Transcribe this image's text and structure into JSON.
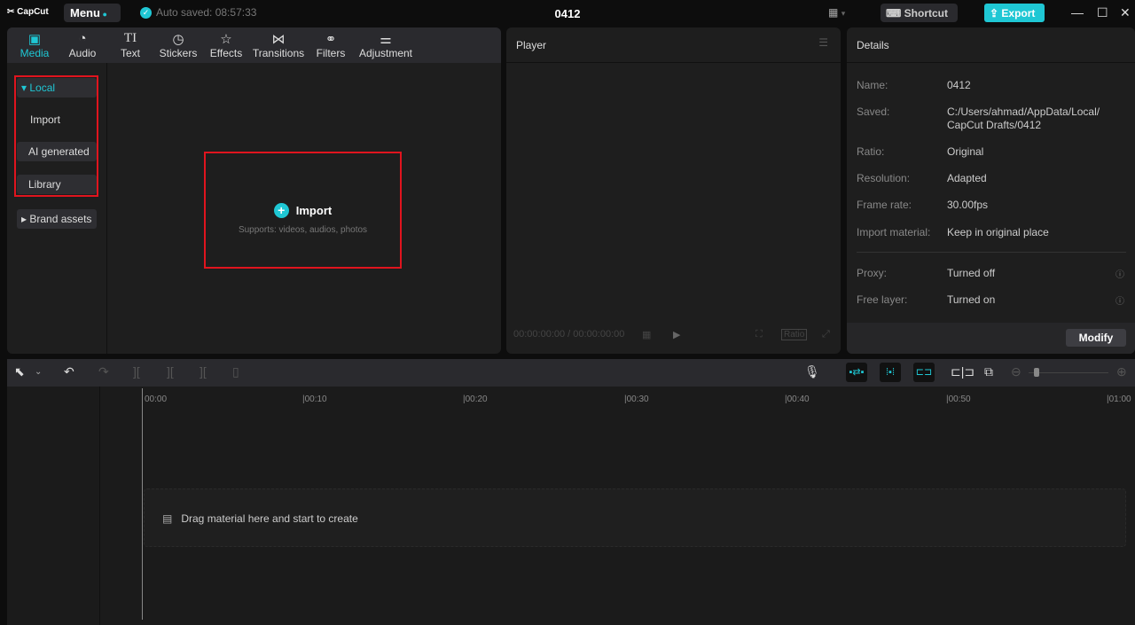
{
  "topbar": {
    "logo": "CapCut",
    "menu": "Menu",
    "autosave": "Auto saved: 08:57:33",
    "project_title": "0412",
    "shortcut": "Shortcut",
    "export": "Export",
    "accent": "#1fc7d4"
  },
  "media": {
    "tabs": [
      {
        "label": "Media",
        "icon": "media-icon"
      },
      {
        "label": "Audio",
        "icon": "audio-icon"
      },
      {
        "label": "Text",
        "icon": "text-icon"
      },
      {
        "label": "Stickers",
        "icon": "stickers-icon"
      },
      {
        "label": "Effects",
        "icon": "effects-icon"
      },
      {
        "label": "Transitions",
        "icon": "transitions-icon"
      },
      {
        "label": "Filters",
        "icon": "filters-icon"
      },
      {
        "label": "Adjustment",
        "icon": "adjustment-icon"
      }
    ],
    "sidebar": {
      "local": "Local",
      "import": "Import",
      "ai_generated": "AI generated",
      "library": "Library",
      "brand_assets": "Brand assets"
    },
    "import_button": "Import",
    "import_hint": "Supports: videos, audios, photos"
  },
  "player": {
    "title": "Player",
    "timecode": "00:00:00:00 / 00:00:00:00",
    "ratio": "Ratio"
  },
  "details": {
    "title": "Details",
    "rows": [
      {
        "label": "Name:",
        "value": "0412"
      },
      {
        "label": "Saved:",
        "value": "C:/Users/ahmad/AppData/Local/ CapCut Drafts/0412"
      },
      {
        "label": "Ratio:",
        "value": "Original"
      },
      {
        "label": "Resolution:",
        "value": "Adapted"
      },
      {
        "label": "Frame rate:",
        "value": "30.00fps"
      },
      {
        "label": "Import material:",
        "value": "Keep in original place"
      },
      {
        "label": "Proxy:",
        "value": "Turned off"
      },
      {
        "label": "Free layer:",
        "value": "Turned on"
      }
    ],
    "modify": "Modify"
  },
  "timeline": {
    "ticks": [
      "00:00",
      "|00:10",
      "|00:20",
      "|00:30",
      "|00:40",
      "|00:50",
      "|01:00"
    ],
    "drop_hint": "Drag material here and start to create"
  }
}
